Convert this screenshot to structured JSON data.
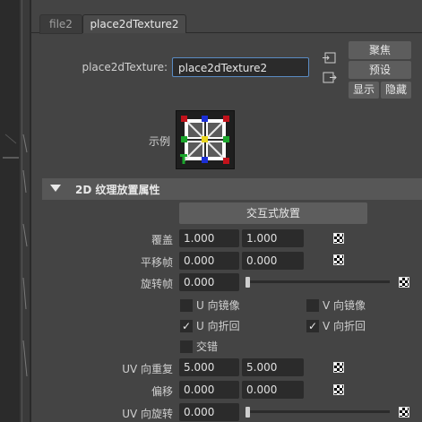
{
  "tabs": [
    {
      "label": "file2",
      "active": false
    },
    {
      "label": "place2dTexture2",
      "active": true
    }
  ],
  "node": {
    "type_label": "place2dTexture:",
    "name_value": "place2dTexture2"
  },
  "side_buttons": {
    "focus": "聚焦",
    "presets": "预设",
    "show": "显示",
    "hide": "隐藏"
  },
  "sample_label": "示例",
  "section": {
    "title": "2D 纹理放置属性",
    "interactive_button": "交互式放置"
  },
  "rows": {
    "coverage": {
      "label": "覆盖",
      "values": [
        "1.000",
        "1.000"
      ]
    },
    "translate_frame": {
      "label": "平移帧",
      "values": [
        "0.000",
        "0.000"
      ]
    },
    "rotate_frame": {
      "label": "旋转帧",
      "value": "0.000",
      "slider_fraction": 0.0
    },
    "repeat_uv": {
      "label": "UV 向重复",
      "values": [
        "5.000",
        "5.000"
      ]
    },
    "offset": {
      "label": "偏移",
      "values": [
        "0.000",
        "0.000"
      ]
    },
    "rotate_uv": {
      "label": "UV 向旋转",
      "value": "0.000",
      "slider_fraction": 0.0
    }
  },
  "checkboxes": {
    "mirror_u": {
      "label": "U 向镜像",
      "checked": false
    },
    "mirror_v": {
      "label": "V 向镜像",
      "checked": false
    },
    "wrap_u": {
      "label": "U 向折回",
      "checked": true
    },
    "wrap_v": {
      "label": "V 向折回",
      "checked": true
    },
    "stagger": {
      "label": "交错",
      "checked": false
    }
  },
  "check_glyph": "✓",
  "colors": {
    "accent_border": "#5a8bc2",
    "panel_bg": "#444444",
    "field_bg": "#2b2b2b"
  }
}
